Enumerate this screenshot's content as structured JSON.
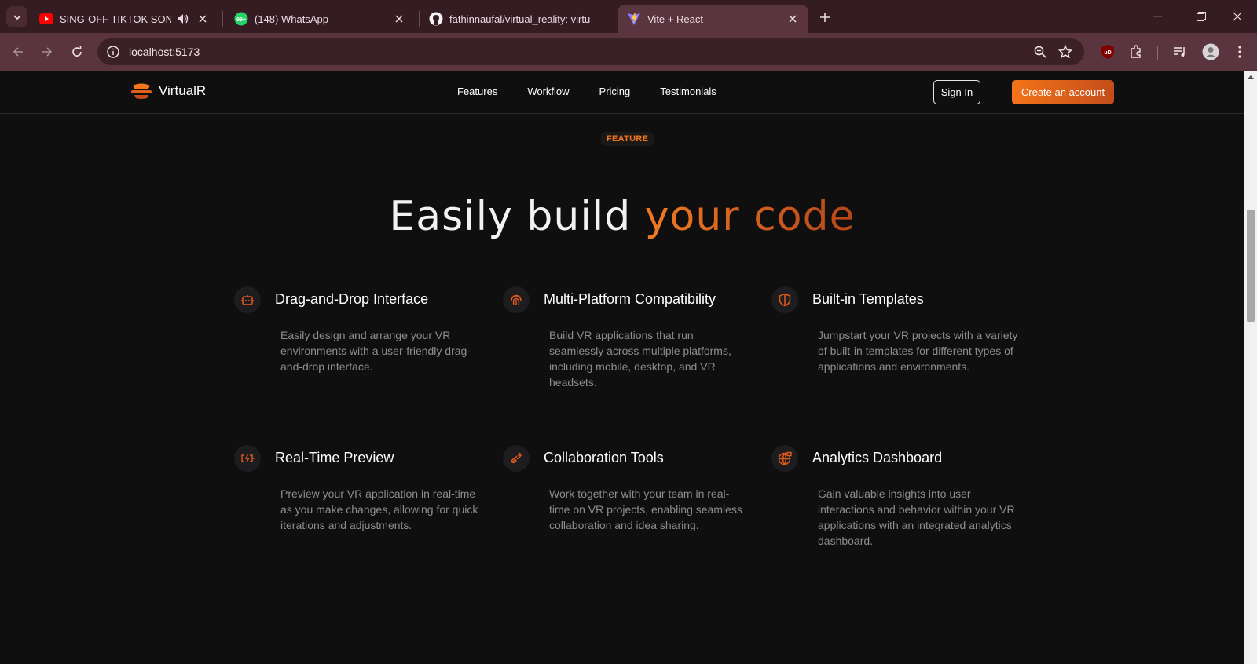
{
  "browser": {
    "tabs": [
      {
        "title": "SING-OFF TIKTOK SONGS P",
        "favicon": "youtube-icon",
        "audio": true
      },
      {
        "title": "(148) WhatsApp",
        "favicon": "whatsapp-icon",
        "badge": "99+"
      },
      {
        "title": "fathinnaufal/virtual_reality: virtu",
        "favicon": "github-icon"
      },
      {
        "title": "Vite + React",
        "favicon": "vite-icon",
        "active": true
      }
    ],
    "url": "localhost:5173",
    "colors": {
      "tabbar": "#351c23",
      "toolbar": "#5a343f"
    }
  },
  "site": {
    "brand": "VirtualR",
    "nav_links": [
      "Features",
      "Workflow",
      "Pricing",
      "Testimonials"
    ],
    "sign_in": "Sign In",
    "create_account": "Create an account",
    "badge": "FEATURE",
    "headline_main": "Easily build ",
    "headline_accent": "your code",
    "accent_color": "#f07a23",
    "features": [
      {
        "title": "Drag-and-Drop Interface",
        "icon": "bot-icon",
        "description": "Easily design and arrange your VR environments with a user-friendly drag-and-drop interface."
      },
      {
        "title": "Multi-Platform Compatibility",
        "icon": "fingerprint-icon",
        "description": "Build VR applications that run seamlessly across multiple platforms, including mobile, desktop, and VR headsets."
      },
      {
        "title": "Built-in Templates",
        "icon": "shield-half-icon",
        "description": "Jumpstart your VR projects with a variety of built-in templates for different types of applications and environments."
      },
      {
        "title": "Real-Time Preview",
        "icon": "battery-charging-icon",
        "description": "Preview your VR application in real-time as you make changes, allowing for quick iterations and adjustments."
      },
      {
        "title": "Collaboration Tools",
        "icon": "plug-zap-icon",
        "description": "Work together with your team in real-time on VR projects, enabling seamless collaboration and idea sharing."
      },
      {
        "title": "Analytics Dashboard",
        "icon": "globe-lock-icon",
        "description": "Gain valuable insights into user interactions and behavior within your VR applications with an integrated analytics dashboard."
      }
    ]
  }
}
